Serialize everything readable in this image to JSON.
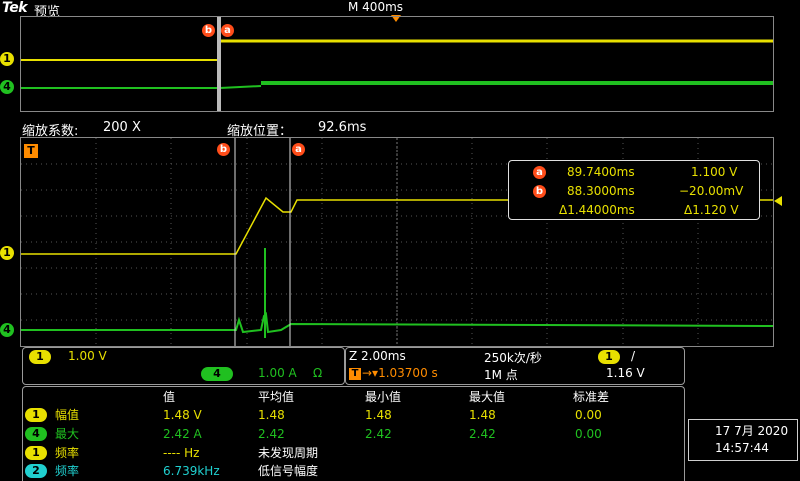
{
  "header": {
    "brand": "Tek",
    "mode": "预览",
    "horizontal": "M 400ms"
  },
  "overview": {
    "ch1_label": "1",
    "ch4_label": "4",
    "marker_b": "b",
    "marker_a": "a"
  },
  "zoom": {
    "factor_label": "缩放系数:",
    "factor_value": "200 X",
    "position_label": "缩放位置：",
    "position_value": "92.6ms",
    "trigger_marker": "T"
  },
  "cursor_readout": {
    "a_time": "89.7400ms",
    "a_value": "1.100 V",
    "b_time": "88.3000ms",
    "b_value": "−20.00mV",
    "delta_time": "Δ1.44000ms",
    "delta_value": "Δ1.120 V"
  },
  "channels": {
    "ch1_badge": "1",
    "ch1_scale": "1.00 V",
    "ch4_badge": "4",
    "ch4_scale": "1.00 A",
    "ch4_coupling": "Ω"
  },
  "timebase": {
    "zoom_scale": "Z 2.00ms",
    "sample_rate": "250k次/秒",
    "trigger_delay": "→▾1.03700 s",
    "record_length": "1M 点",
    "trigger_source": "1",
    "trigger_slope": "/",
    "trigger_level": "1.16 V"
  },
  "measurements": {
    "headers": [
      "值",
      "平均值",
      "最小值",
      "最大值",
      "标准差"
    ],
    "rows": [
      {
        "badge": "1",
        "name": "幅值",
        "value": "1.48 V",
        "mean": "1.48",
        "min": "1.48",
        "max": "1.48",
        "std": "0.00"
      },
      {
        "badge": "4",
        "name": "最大",
        "value": "2.42 A",
        "mean": "2.42",
        "min": "2.42",
        "max": "2.42",
        "std": "0.00"
      },
      {
        "badge": "1",
        "name": "频率",
        "value": "---- Hz",
        "note": "未发现周期"
      },
      {
        "badge": "2",
        "name": "频率",
        "value": "6.739kHz",
        "note": "低信号幅度"
      }
    ]
  },
  "clock": {
    "date": "17 7月 2020",
    "time": "14:57:44"
  },
  "colors": {
    "ch1": "#e8e000",
    "ch4": "#20c020",
    "ch2": "#20d0d0",
    "cursor": "#ff4d1a",
    "grid": "#666666"
  }
}
